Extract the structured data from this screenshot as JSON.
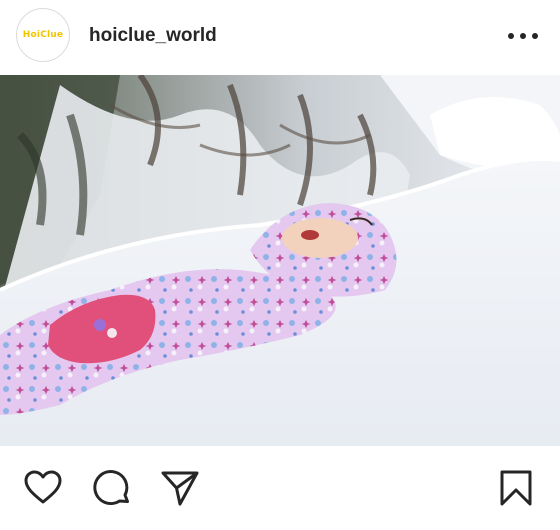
{
  "post": {
    "username": "hoiclue_world",
    "avatar_logo_text": "HoiClue",
    "more_icon": "more-horizontal-icon",
    "photo_description": "Child in a pink snowflake-print snowsuit lying on her back in deep snow, snow-covered trees in background"
  },
  "actions": {
    "like_icon": "heart-icon",
    "comment_icon": "comment-icon",
    "share_icon": "paper-plane-icon",
    "save_icon": "bookmark-icon"
  },
  "colors": {
    "text": "#262626",
    "logo": "#f2c500",
    "snowsuit": "#e2c6ef",
    "mitten": "#e0507a"
  }
}
